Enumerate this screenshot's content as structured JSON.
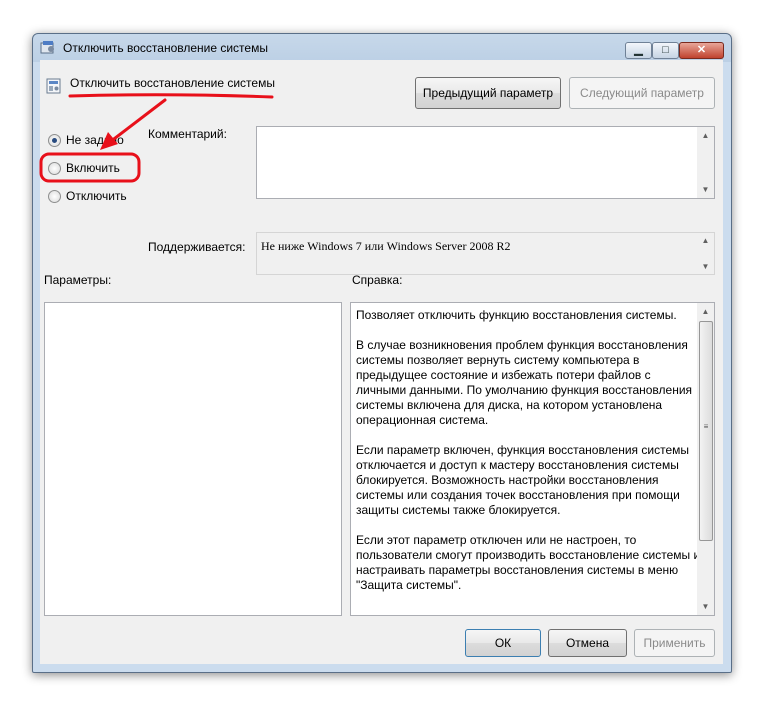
{
  "window": {
    "title": "Отключить восстановление системы",
    "icon": "policy-setting-icon"
  },
  "header": {
    "setting_title": "Отключить восстановление системы",
    "prev_button": "Предыдущий параметр",
    "next_button": "Следующий параметр"
  },
  "state": {
    "options": [
      {
        "label": "Не задано",
        "selected": true
      },
      {
        "label": "Включить",
        "selected": false
      },
      {
        "label": "Отключить",
        "selected": false
      }
    ]
  },
  "comment": {
    "label": "Комментарий:",
    "value": ""
  },
  "supported": {
    "label": "Поддерживается:",
    "value": "Не ниже Windows 7 или Windows Server 2008 R2"
  },
  "params": {
    "label": "Параметры:"
  },
  "help": {
    "label": "Справка:",
    "paragraphs": [
      "Позволяет отключить функцию восстановления системы.",
      "В случае возникновения проблем функция восстановления системы позволяет вернуть систему компьютера в предыдущее состояние и избежать потери файлов с личными данными. По умолчанию функция восстановления системы включена для диска, на котором установлена операционная система.",
      "Если параметр включен, функция восстановления системы отключается и доступ к мастеру восстановления системы блокируется. Возможность настройки восстановления системы или создания точек восстановления при помощи защиты системы также блокируется.",
      "Если этот параметр отключен или не настроен, то пользователи смогут производить восстановление системы и настраивать параметры восстановления системы в меню \"Защита системы\"."
    ]
  },
  "footer": {
    "ok": "ОК",
    "cancel": "Отмена",
    "apply": "Применить"
  },
  "colors": {
    "annotation": "#e8101a",
    "window_frame": "#bcd0e5",
    "client": "#f0f0f0"
  }
}
